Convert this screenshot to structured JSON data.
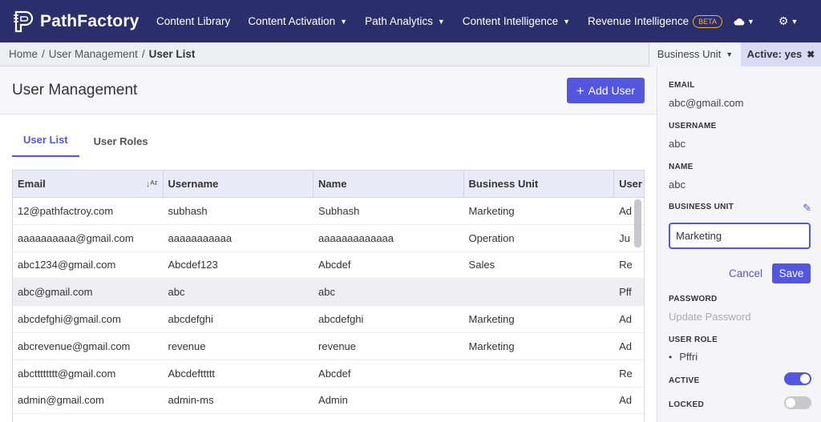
{
  "nav": {
    "logo_text": "PathFactory",
    "items": [
      {
        "label": "Content Library",
        "caret": false
      },
      {
        "label": "Content Activation",
        "caret": true
      },
      {
        "label": "Path Analytics",
        "caret": true
      },
      {
        "label": "Content Intelligence",
        "caret": true
      },
      {
        "label": "Revenue Intelligence",
        "caret": false
      }
    ],
    "beta_label": "BETA",
    "icons": [
      "cloud-icon",
      "gear-icon"
    ]
  },
  "breadcrumb": {
    "items": [
      "Home",
      "User Management",
      "User List"
    ],
    "separator": "/"
  },
  "filters": {
    "business_unit_label": "Business Unit",
    "active_label": "Active: yes"
  },
  "page": {
    "title": "User Management",
    "add_button_label": "Add User"
  },
  "tabs": [
    {
      "label": "User List",
      "active": true
    },
    {
      "label": "User Roles",
      "active": false
    }
  ],
  "table": {
    "columns": [
      "Email",
      "Username",
      "Name",
      "Business Unit",
      "User"
    ],
    "rows": [
      [
        "12@pathfactroy.com",
        "subhash",
        "Subhash",
        "Marketing",
        "Ad"
      ],
      [
        "aaaaaaaaaa@gmail.com",
        "aaaaaaaaaaa",
        "aaaaaaaaaaaaa",
        "Operation",
        "Ju"
      ],
      [
        "abc1234@gmail.com",
        "Abcdef123",
        "Abcdef",
        "Sales",
        "Re"
      ],
      [
        "abc@gmail.com",
        "abc",
        "abc",
        "",
        "Pff"
      ],
      [
        "abcdefghi@gmail.com",
        "abcdefghi",
        "abcdefghi",
        "Marketing",
        "Ad"
      ],
      [
        "abcrevenue@gmail.com",
        "revenue",
        "revenue",
        "Marketing",
        "Ad"
      ],
      [
        "abctttttttt@gmail.com",
        "Abcdefttttt",
        "Abcdef",
        "",
        "Re"
      ],
      [
        "admin@gmail.com",
        "admin-ms",
        "Admin",
        "",
        "Ad"
      ],
      [
        "",
        "",
        "",
        "",
        ""
      ]
    ],
    "highlighted_row": 3
  },
  "panel": {
    "email_label": "EMAIL",
    "email_value": "abc@gmail.com",
    "username_label": "USERNAME",
    "username_value": "abc",
    "name_label": "NAME",
    "name_value": "abc",
    "business_unit_label": "BUSINESS UNIT",
    "business_unit_value": "Marketing",
    "cancel_label": "Cancel",
    "save_label": "Save",
    "password_label": "PASSWORD",
    "password_link": "Update Password",
    "user_role_label": "USER ROLE",
    "user_role_value": "Pffri",
    "active_label": "ACTIVE",
    "active_on": true,
    "locked_label": "LOCKED",
    "locked_on": false
  },
  "colors": {
    "nav_bg": "#2a2f6b",
    "accent": "#5356e0",
    "beta": "#f2b33d"
  }
}
